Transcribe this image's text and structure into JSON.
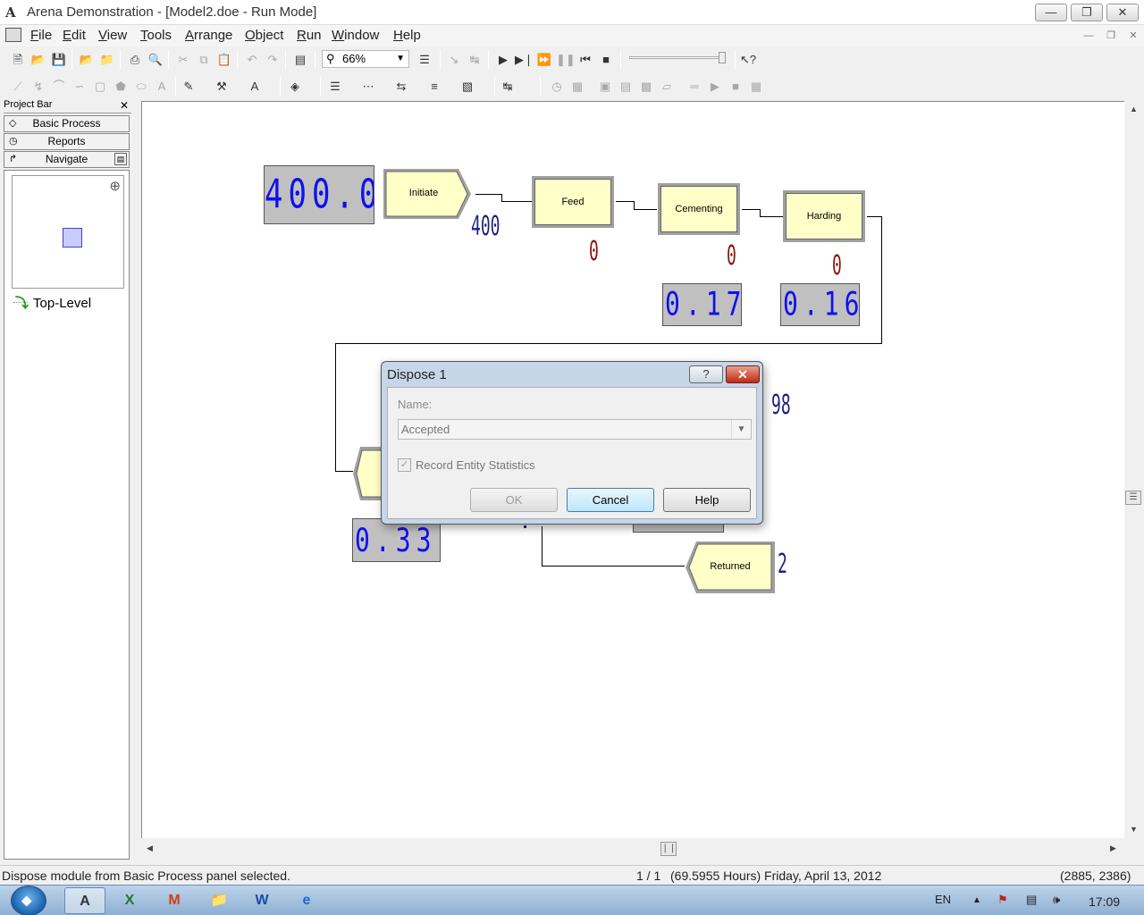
{
  "window": {
    "title": "Arena Demonstration - [Model2.doe - Run Mode]",
    "app_icon": "arena-icon",
    "controls": [
      "minimize",
      "restore",
      "close"
    ]
  },
  "menu": {
    "items": [
      "File",
      "Edit",
      "View",
      "Tools",
      "Arrange",
      "Object",
      "Run",
      "Window",
      "Help"
    ]
  },
  "toolbar": {
    "zoom": "66%"
  },
  "project_bar": {
    "title": "Project Bar",
    "panels": [
      "Basic Process",
      "Reports",
      "Navigate"
    ],
    "tree": {
      "item": "Top-Level"
    }
  },
  "model": {
    "create_counter": "400.00",
    "modules": {
      "initiate": "Initiate",
      "feed": "Feed",
      "cementing": "Cementing",
      "harding": "Harding",
      "returned": "Returned"
    },
    "counters": {
      "initiate_out": "400",
      "feed_queue": "0",
      "cementing_queue": "0",
      "harding_queue": "0",
      "partial_98": "98",
      "returned_count": "2"
    },
    "displays": {
      "cementing_util": "0.17",
      "harding_util": "0.16",
      "dispose_util": "0.33"
    }
  },
  "dialog": {
    "title": "Dispose 1",
    "name_label": "Name:",
    "name_value": "Accepted",
    "record_stats_label": "Record Entity Statistics",
    "record_stats_checked": true,
    "ok": "OK",
    "cancel": "Cancel",
    "help": "Help"
  },
  "status": {
    "message": "Dispose module from Basic Process panel selected.",
    "page": "1 / 1",
    "sim_time": "(69.5955 Hours) Friday, April 13, 2012",
    "coords": "(2885, 2386)"
  },
  "taskbar": {
    "language": "EN",
    "clock": "17:09"
  }
}
